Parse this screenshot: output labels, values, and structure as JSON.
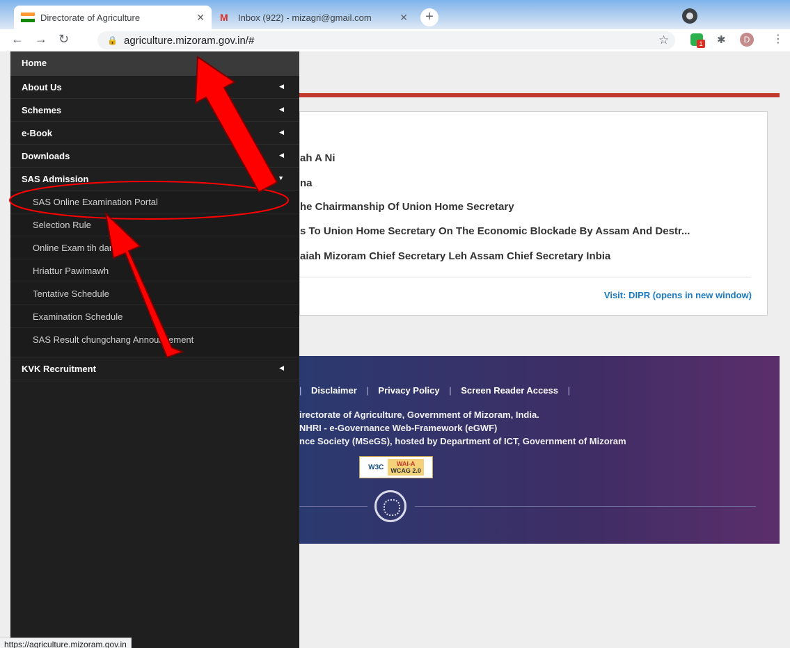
{
  "browser": {
    "tabs": [
      {
        "title": "Directorate of Agriculture"
      },
      {
        "title": "Inbox (922) - mizagri@gmail.com"
      }
    ],
    "new_tab_label": "+",
    "close_glyph": "✕",
    "url": "agriculture.mizoram.gov.in/#",
    "status_url": "https://agriculture.mizoram.gov.in",
    "profile_initial": "D",
    "extension_badge": "1"
  },
  "sidebar": {
    "home": "Home",
    "items": [
      {
        "label": "About Us"
      },
      {
        "label": "Schemes"
      },
      {
        "label": "e-Book"
      },
      {
        "label": "Downloads"
      },
      {
        "label": "SAS Admission"
      }
    ],
    "sub_items": [
      {
        "label": "SAS Online Examination Portal"
      },
      {
        "label": "Selection Rule"
      },
      {
        "label": "Online Exam tih dan tur"
      },
      {
        "label": "Hriattur Pawimawh"
      },
      {
        "label": "Tentative Schedule"
      },
      {
        "label": "Examination Schedule"
      },
      {
        "label": "SAS Result chungchang Announcement"
      }
    ],
    "kvk": "KVK Recruitment"
  },
  "news": {
    "items": [
      "ah A Ni",
      "na",
      "he Chairmanship Of Union Home Secretary",
      "s To Union Home Secretary On The Economic Blockade By Assam And Destr...",
      "aiah Mizoram Chief Secretary Leh Assam Chief Secretary Inbia"
    ],
    "visit": "Visit: DIPR (opens in new window)"
  },
  "footer": {
    "links": [
      "Disclaimer",
      "Privacy Policy",
      "Screen Reader Access"
    ],
    "lines": [
      "irectorate of Agriculture, Government of Mizoram, India.",
      "NHRI - e-Governance Web-Framework (eGWF)",
      "nce Society (MSeGS), hosted by Department of ICT, Government of Mizoram"
    ],
    "badge_w3c": "W3C",
    "badge_level": "WAI-A",
    "badge_wcag": "WCAG 2.0"
  },
  "colors": {
    "sidebar_bg": "#1f1f1f",
    "accent_red": "#c0392b",
    "annotation_red": "#ff0000",
    "link_blue": "#1a7abf"
  }
}
